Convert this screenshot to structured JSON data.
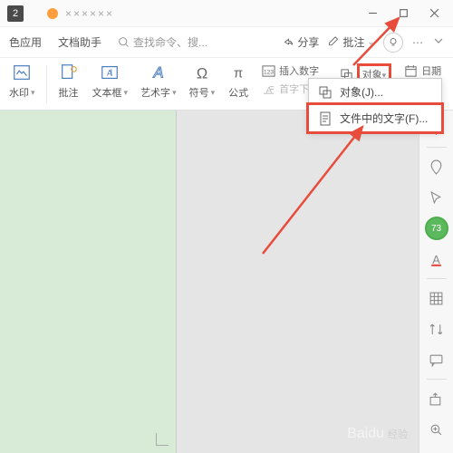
{
  "titlebar": {
    "tab_count": "2",
    "doc_title": "××××××"
  },
  "topbar": {
    "theme_app": "色应用",
    "doc_assistant": "文档助手",
    "search_placeholder": "查找命令、搜...",
    "share": "分享",
    "annotation": "批注"
  },
  "ribbon": {
    "watermark": "水印",
    "annotate": "批注",
    "textbox": "文本框",
    "wordart": "艺术字",
    "symbol": "符号",
    "formula": "公式",
    "insert_number": "插入数字",
    "drop_cap": "首字下沉",
    "object": "对象",
    "date": "日期"
  },
  "dropdown": {
    "object_item": "对象(J)...",
    "text_from_file": "文件中的文字(F)..."
  },
  "side": {
    "badge": "73"
  },
  "watermark": {
    "brand": "Baidu",
    "sub": "经验"
  }
}
